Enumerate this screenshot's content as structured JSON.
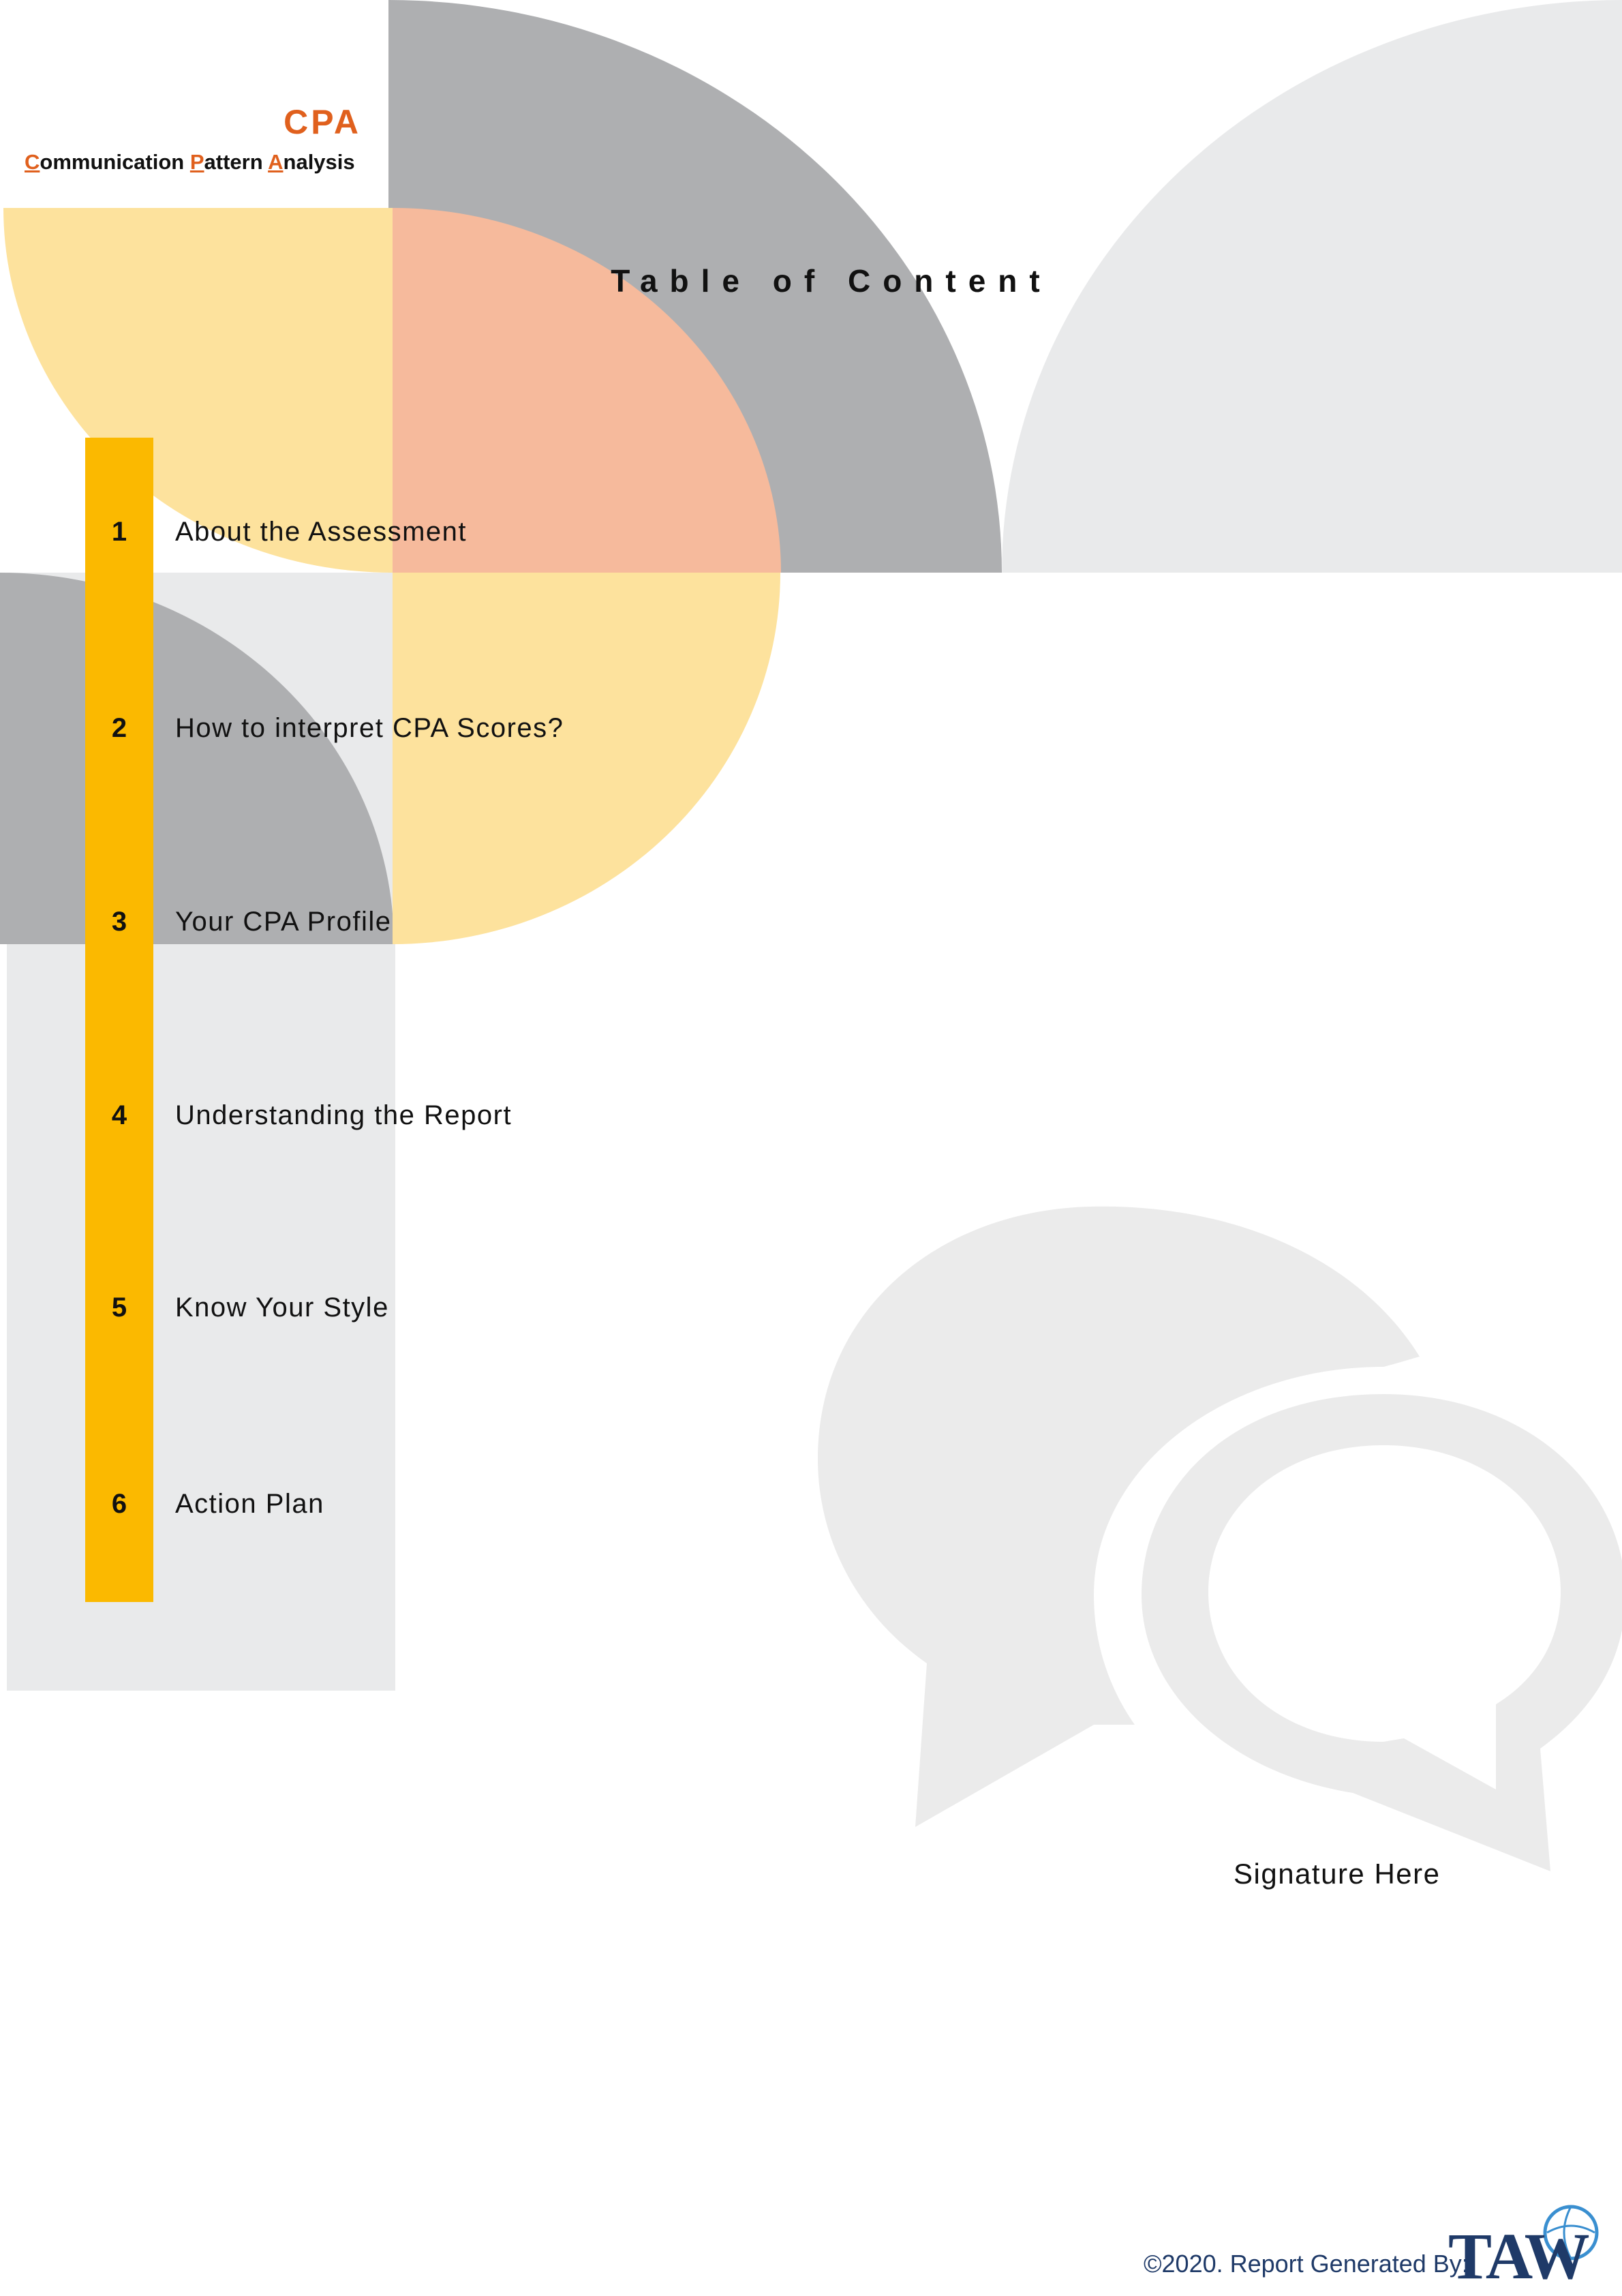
{
  "colors": {
    "accent_orange": "#e0601d",
    "toc_bar": "#fbb900",
    "light_gray": "#e9eaeb",
    "mid_gray": "#aeafb1",
    "pale_yellow": "#fde29d",
    "salmon": "#f6ba9c",
    "bubble_gray": "#ebebeb",
    "logo_navy": "#1f3a68"
  },
  "brand": {
    "acronym": "CPA",
    "subtitle_parts": [
      {
        "initial": "C",
        "rest": "ommunication "
      },
      {
        "initial": "P",
        "rest": "attern "
      },
      {
        "initial": "A",
        "rest": "nalysis"
      }
    ]
  },
  "toc": {
    "title": "Table of Content",
    "items": [
      {
        "num": "1",
        "label": "About the Assessment"
      },
      {
        "num": "2",
        "label": "How to interpret CPA Scores?"
      },
      {
        "num": "3",
        "label": "Your CPA Profile"
      },
      {
        "num": "4",
        "label": "Understanding the Report"
      },
      {
        "num": "5",
        "label": "Know Your Style"
      },
      {
        "num": "6",
        "label": "Action Plan"
      }
    ]
  },
  "signature_label": "Signature Here",
  "footer": {
    "text": "©2020. Report Generated By:",
    "logo_text": "TAW",
    "icon": "speech-bubbles-icon"
  }
}
